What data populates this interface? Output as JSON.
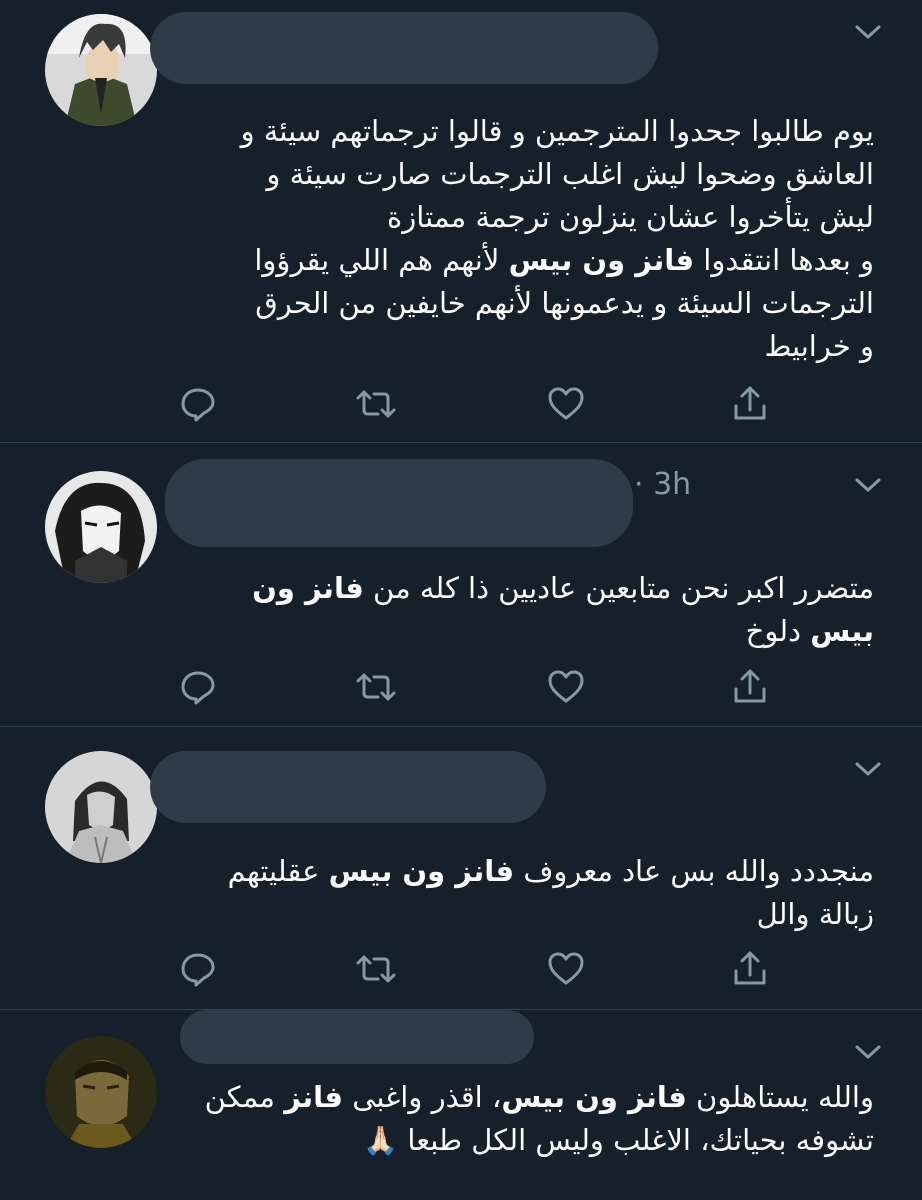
{
  "tweets": [
    {
      "time": "",
      "lines": [
        [
          "يوم طالبوا جحدوا المترجمين و قالوا ترجماتهم سيئة و"
        ],
        [
          "العاشق وضحوا ليش اغلب الترجمات صارت سيئة و"
        ],
        [
          "ليش يتأخروا عشان ينزلون ترجمة ممتازة"
        ],
        [
          "و بعدها انتقدوا ",
          {
            "b": "فانز ون بيس"
          },
          " لأنهم هم اللي يقرؤوا"
        ],
        [
          "الترجمات السيئة و يدعمونها لأنهم خايفين من الحرق"
        ],
        [
          "و خرابيط"
        ]
      ]
    },
    {
      "time": "· 3h",
      "lines": [
        [
          "متضرر اكبر نحن متابعين عاديين ذا كله من ",
          {
            "b": "فانز ون"
          }
        ],
        [
          {
            "b": "بيس"
          },
          " دلوخ"
        ]
      ]
    },
    {
      "time": "",
      "lines": [
        [
          "منجددد والله بس عاد معروف ",
          {
            "b": "فانز ون بيس"
          },
          " عقليتهم"
        ],
        [
          "زبالة والل"
        ]
      ]
    },
    {
      "time": "",
      "lines": [
        [
          "والله يستاهلون ",
          {
            "b": "فانز ون بيس"
          },
          "، اقذر واغبى ",
          {
            "b": "فانز"
          },
          " ممكن"
        ],
        [
          "تشوفه بحياتك، الاغلب وليس الكل طبعا ",
          {
            "emoji": "🙏🏻"
          }
        ]
      ]
    }
  ],
  "icons": {
    "reply": "reply-icon",
    "retweet": "retweet-icon",
    "like": "like-icon",
    "share": "share-icon",
    "more": "chevron-down-icon"
  },
  "colors": {
    "background": "#15202b",
    "text": "#ffffff",
    "secondary": "#8899a6",
    "divider": "#38444d",
    "redaction": "#2f3b46"
  }
}
